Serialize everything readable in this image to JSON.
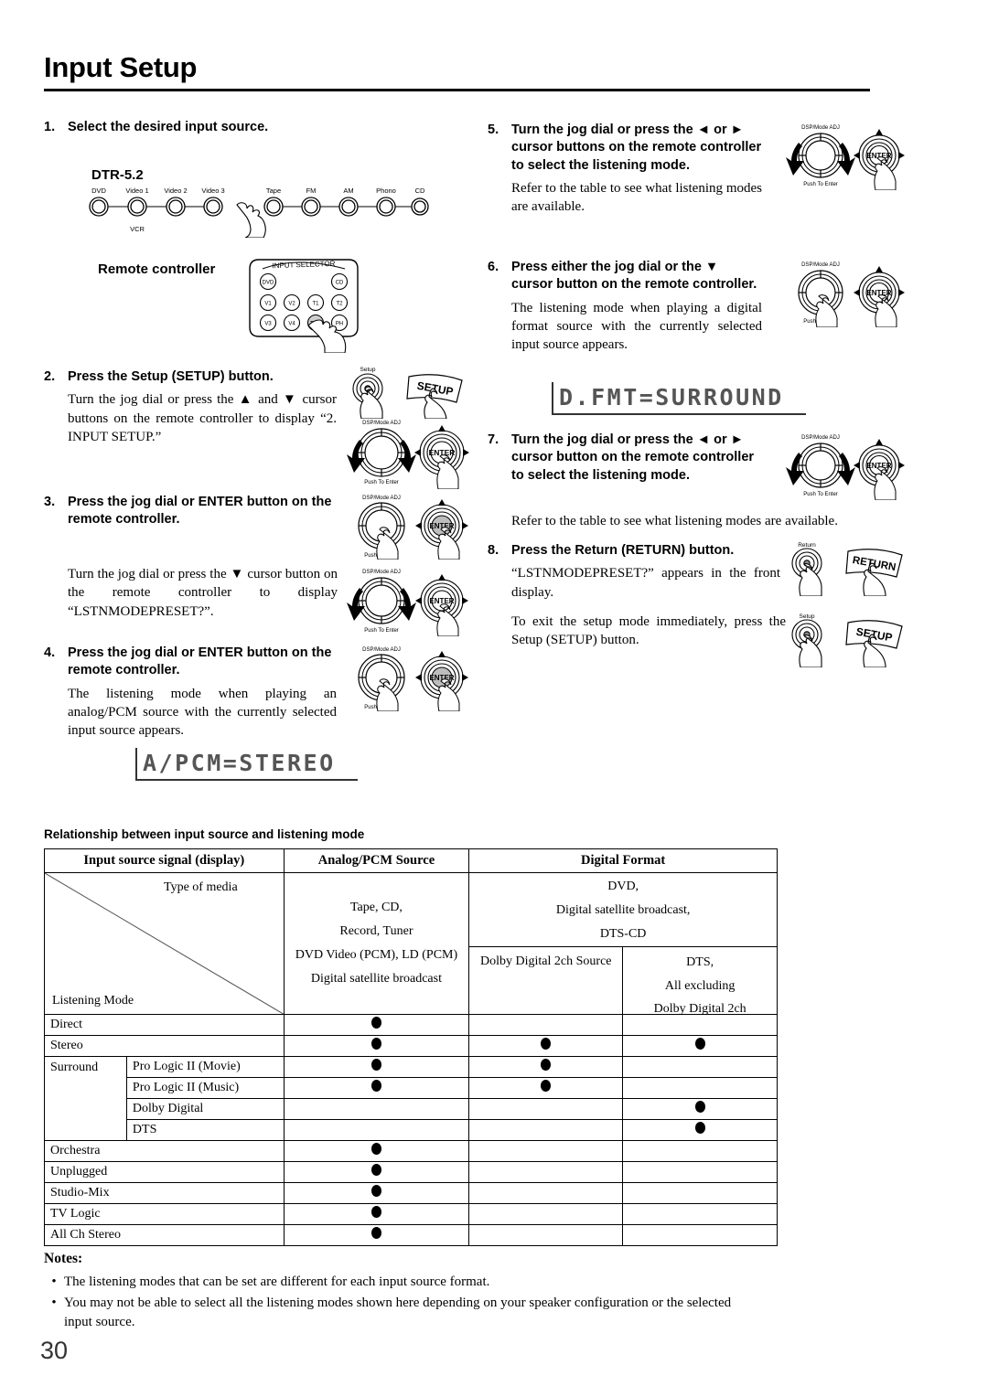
{
  "document": {
    "title": "Input Setup",
    "page_number": "30"
  },
  "steps": {
    "s1": {
      "num": "1.",
      "head": "Select the desired input source.",
      "device_label": "DTR-5.2",
      "remote_label": "Remote controller",
      "knobs_left": [
        "DVD",
        "Video 1",
        "Video 2",
        "Video 3"
      ],
      "knob_sub": "VCR",
      "knobs_right": [
        "Tape",
        "FM",
        "AM",
        "Phono",
        "CD"
      ],
      "remote_panel_title": "INPUT SELECTOR",
      "remote_buttons_row1": [
        "DVD",
        "CD"
      ],
      "remote_buttons_row2": [
        "V1",
        "V2",
        "T1",
        "T2"
      ],
      "remote_buttons_row3": [
        "V3",
        "V4",
        "TUN",
        "PH"
      ]
    },
    "s2": {
      "num": "2.",
      "head": "Press the Setup (SETUP) button.",
      "body": "Turn the jog dial or press the ▲ and ▼ cursor buttons on the remote controller to display “2. INPUT SETUP.”"
    },
    "s3": {
      "num": "3.",
      "head": "Press the jog dial or ENTER button on the remote controller.",
      "body": "Turn the jog dial or press the ▼ cursor button on the remote controller to display “LSTNMODEPRESET?”."
    },
    "s4": {
      "num": "4.",
      "head": "Press the jog dial or ENTER button on the remote controller.",
      "body": "The listening mode when playing an analog/PCM source with the currently selected input source appears.",
      "lcd": "A/PCM=STEREO"
    },
    "s5": {
      "num": "5.",
      "head": "Turn the jog dial or press the ◄ or ► cursor buttons on the remote controller to select the listening mode.",
      "body": "Refer to the table to see what listening modes are available."
    },
    "s6": {
      "num": "6.",
      "head": "Press either the jog dial or the ▼ cursor button on the remote controller.",
      "body": "The listening mode when playing a digital format source with the currently selected input source appears.",
      "lcd": "D.FMT=SURROUND"
    },
    "s7": {
      "num": "7.",
      "head": "Turn the jog dial or press the ◄ or ► cursor button on the remote controller to select the listening mode.",
      "body": "Refer to the table to see what listening modes are available."
    },
    "s8": {
      "num": "8.",
      "head": "Press the Return (RETURN) button.",
      "body": "“LSTNMODEPRESET?” appears in the front display.",
      "body2": "To exit the setup mode immediately, press the Setup (SETUP) button."
    }
  },
  "illustrations": {
    "jog_top_label": "DSP/Mode ADJ",
    "jog_bottom_label": "Push To Enter",
    "enter_label": "ENTER",
    "setup_button_small": "Setup",
    "setup_button_remote": "SETUP",
    "return_button_small": "Return",
    "return_button_remote": "RETURN"
  },
  "table": {
    "caption": "Relationship between input source and listening mode",
    "headers": [
      "Input source signal (display)",
      "Analog/PCM Source",
      "Digital Format"
    ],
    "corner": {
      "top_right_label": "Type of media",
      "bottom_left_label": "Listening Mode"
    },
    "media": {
      "analog_pcm": [
        "Tape, CD,",
        "Record, Tuner",
        "DVD Video (PCM), LD (PCM)",
        "Digital satellite broadcast"
      ],
      "digital_top": [
        "DVD,",
        "Digital satellite broadcast,",
        "DTS-CD"
      ],
      "digital_sub_left": [
        "Dolby Digital 2ch Source"
      ],
      "digital_sub_right": [
        "DTS,",
        "All excluding",
        "Dolby Digital 2ch"
      ]
    },
    "rows": [
      {
        "group": "",
        "label": "Direct",
        "analog": true,
        "dd2ch": false,
        "dts": false
      },
      {
        "group": "",
        "label": "Stereo",
        "analog": true,
        "dd2ch": true,
        "dts": true
      },
      {
        "group": "Surround",
        "label": "Pro Logic II (Movie)",
        "analog": true,
        "dd2ch": true,
        "dts": false
      },
      {
        "group": "",
        "label": "Pro Logic II (Music)",
        "analog": true,
        "dd2ch": true,
        "dts": false
      },
      {
        "group": "",
        "label": "Dolby Digital",
        "analog": false,
        "dd2ch": false,
        "dts": true
      },
      {
        "group": "",
        "label": "DTS",
        "analog": false,
        "dd2ch": false,
        "dts": true
      },
      {
        "group": "",
        "label": "Orchestra",
        "analog": true,
        "dd2ch": false,
        "dts": false
      },
      {
        "group": "",
        "label": "Unplugged",
        "analog": true,
        "dd2ch": false,
        "dts": false
      },
      {
        "group": "",
        "label": "Studio-Mix",
        "analog": true,
        "dd2ch": false,
        "dts": false
      },
      {
        "group": "",
        "label": "TV Logic",
        "analog": true,
        "dd2ch": false,
        "dts": false
      },
      {
        "group": "",
        "label": "All Ch Stereo",
        "analog": true,
        "dd2ch": false,
        "dts": false
      }
    ]
  },
  "notes": {
    "title": "Notes:",
    "bullet": "•",
    "items": [
      "The listening modes that can be set are different for each input source format.",
      "You may not be able to select all the listening modes shown here depending on your speaker configuration or the selected input source."
    ]
  }
}
